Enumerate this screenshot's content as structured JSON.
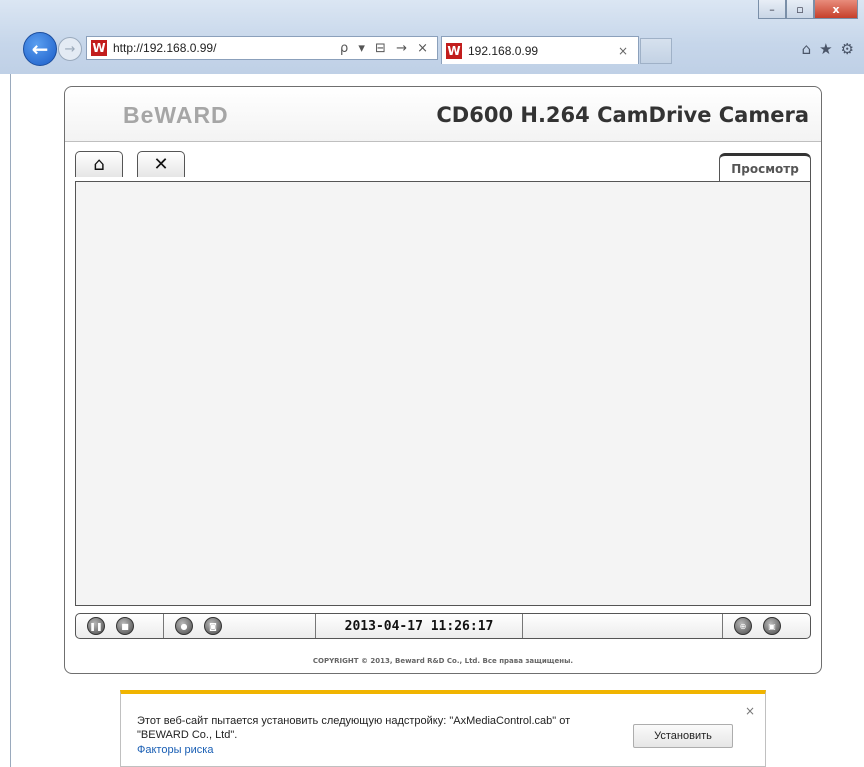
{
  "browser": {
    "url": "http://192.168.0.99/",
    "tab_title": "192.168.0.99",
    "tab_close": "×",
    "address_tools": "ρ ▾ ⊟ → ×",
    "favicon_letter": "W",
    "window_buttons": {
      "minimize": "–",
      "maximize": "▫",
      "close": "x"
    },
    "back": "←",
    "forward": "→",
    "right_icons": {
      "home": "⌂",
      "favorites": "★",
      "settings": "⚙"
    }
  },
  "camera_page": {
    "logo": "BeWARD",
    "title": "CD600 H.264 CamDrive Camera",
    "nav": {
      "home_icon": "home-icon",
      "settings_icon": "tools-icon",
      "home_glyph": "⌂",
      "tools_glyph": "✕"
    },
    "view_tab": "Просмотр",
    "timestamp": "2013-04-17 11:26:17",
    "controls": {
      "pause": "pause-icon",
      "stop": "stop-icon",
      "record": "record-icon",
      "snapshot": "camera-icon",
      "zoom": "zoom-icon",
      "fullscreen": "fullscreen-icon"
    },
    "copyright": "COPYRIGHT © 2013, Beward R&D Co., Ltd. Все права защищены."
  },
  "notification": {
    "message": "Этот веб-сайт пытается установить следующую надстройку: \"AxMediaControl.cab\" от \"BEWARD Co., Ltd\".",
    "risk_link": "Факторы риска",
    "install_button": "Установить",
    "close": "×"
  },
  "colors": {
    "notification_accent": "#f0b400",
    "logo": "#a6a6a6",
    "back_button": "#1a5cc8"
  }
}
